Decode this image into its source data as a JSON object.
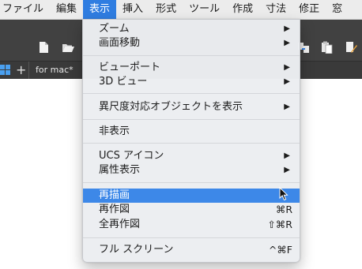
{
  "menubar": {
    "items": [
      "ファイル",
      "編集",
      "表示",
      "挿入",
      "形式",
      "ツール",
      "作成",
      "寸法",
      "修正",
      "窓"
    ],
    "active_index": 2
  },
  "toolbar": {
    "icons": [
      "new-file-icon",
      "open-folder-icon",
      "copy-properties-icon",
      "paste-icon",
      "edit-icon"
    ]
  },
  "tabbar": {
    "add_label": "+",
    "tab_label": "for mac*"
  },
  "view_menu": {
    "zoom": {
      "label": "ズーム",
      "submenu": "▶"
    },
    "pan": {
      "label": "画面移動",
      "submenu": "▶"
    },
    "viewports": {
      "label": "ビューポート",
      "submenu": "▶"
    },
    "view3d": {
      "label": "3D ビュー",
      "submenu": "▶"
    },
    "show_objects": {
      "label": "異尺度対応オブジェクトを表示",
      "submenu": "▶"
    },
    "hide": {
      "label": "非表示"
    },
    "ucs_icon": {
      "label": "UCS アイコン",
      "submenu": "▶"
    },
    "attr_display": {
      "label": "属性表示",
      "submenu": "▶"
    },
    "redraw": {
      "label": "再描画"
    },
    "regen": {
      "label": "再作図",
      "shortcut": "⌘R"
    },
    "regen_all": {
      "label": "全再作図",
      "shortcut": "⇧⌘R"
    },
    "fullscreen": {
      "label": "フル スクリーン",
      "shortcut": "^⌘F"
    }
  },
  "colors": {
    "accent": "#3d88e8",
    "menubar_active": "#2f7de1",
    "toolbar_bg": "#414141"
  }
}
